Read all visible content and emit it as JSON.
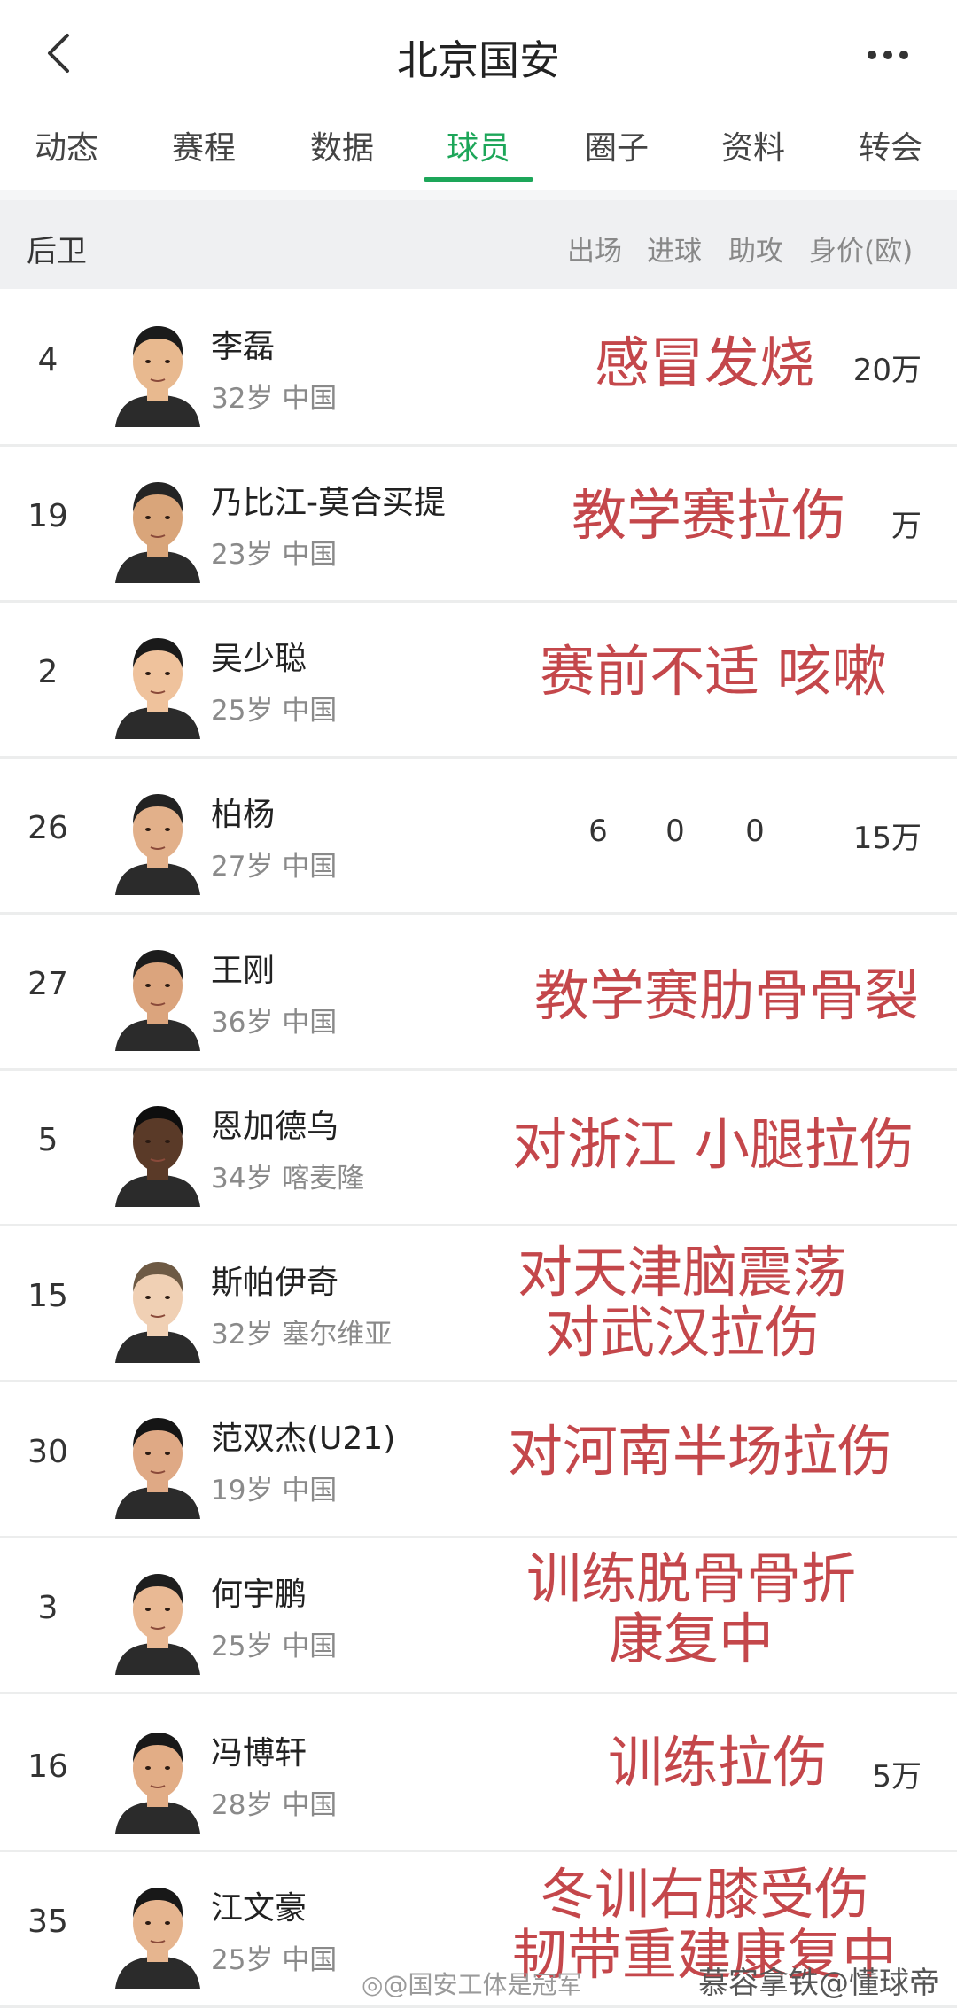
{
  "header": {
    "title": "北京国安"
  },
  "tabs": [
    "动态",
    "赛程",
    "数据",
    "球员",
    "圈子",
    "资料",
    "转会"
  ],
  "active_tab": "球员",
  "section": {
    "title": "后卫",
    "columns": [
      "出场",
      "进球",
      "助攻",
      "身价(欧)"
    ]
  },
  "players": [
    {
      "number": "4",
      "name": "李磊",
      "meta": "32岁 中国",
      "value": "20万",
      "note": [
        "感冒发烧"
      ]
    },
    {
      "number": "19",
      "name": "乃比江-莫合买提",
      "meta": "23岁 中国",
      "value": "万",
      "note": [
        "教学赛拉伤"
      ]
    },
    {
      "number": "2",
      "name": "吴少聪",
      "meta": "25岁 中国",
      "value": "",
      "note": [
        "赛前不适 咳嗽"
      ]
    },
    {
      "number": "26",
      "name": "柏杨",
      "meta": "27岁 中国",
      "appearances": "6",
      "goals": "0",
      "assists": "0",
      "value": "15万",
      "note": []
    },
    {
      "number": "27",
      "name": "王刚",
      "meta": "36岁 中国",
      "value": "",
      "note": [
        "教学赛肋骨骨裂"
      ]
    },
    {
      "number": "5",
      "name": "恩加德乌",
      "meta": "34岁 喀麦隆",
      "value": "",
      "note": [
        "对浙江 小腿拉伤"
      ]
    },
    {
      "number": "15",
      "name": "斯帕伊奇",
      "meta": "32岁 塞尔维亚",
      "value": "",
      "note": [
        "对天津脑震荡",
        "对武汉拉伤"
      ]
    },
    {
      "number": "30",
      "name": "范双杰(U21)",
      "meta": "19岁 中国",
      "value": "",
      "note": [
        "对河南半场拉伤"
      ]
    },
    {
      "number": "3",
      "name": "何宇鹏",
      "meta": "25岁 中国",
      "value": "",
      "note": [
        "训练脱骨骨折",
        "康复中"
      ]
    },
    {
      "number": "16",
      "name": "冯博轩",
      "meta": "28岁 中国",
      "value": "5万",
      "note": [
        "训练拉伤"
      ]
    },
    {
      "number": "35",
      "name": "江文豪",
      "meta": "25岁 中国",
      "value": "",
      "note": [
        "冬训右膝受伤",
        "韧带重建康复中"
      ]
    }
  ],
  "watermarks": {
    "weibo": "@国安工体是冠军",
    "author": "慕容拿铁@懂球帝"
  },
  "icons": {
    "back": "chevron-left-icon",
    "more": "more-dots-icon",
    "weibo": "weibo-icon"
  },
  "colors": {
    "accent": "#1da659",
    "note_text": "#c4474b"
  }
}
